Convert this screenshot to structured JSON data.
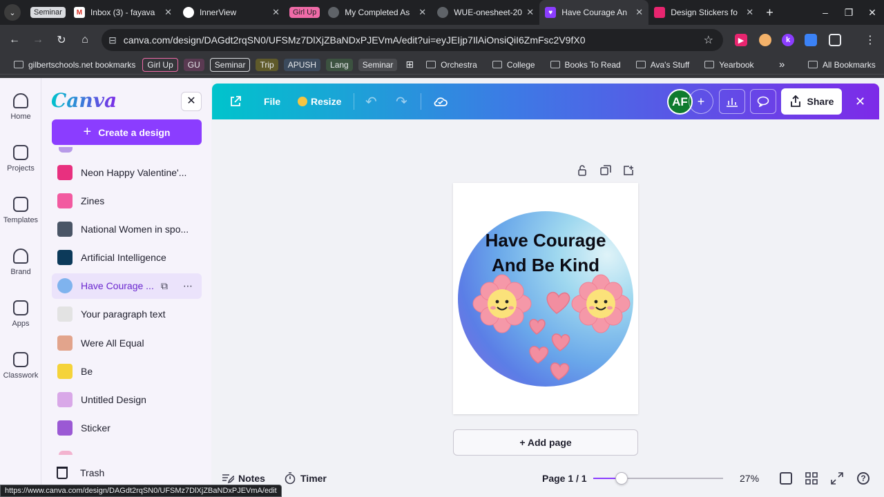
{
  "browser": {
    "tabs": [
      {
        "label": "Seminar",
        "kind": "group",
        "color": "#dadce0",
        "text": "#202124"
      },
      {
        "label": "Inbox (3) - fayava",
        "icon": "gmail-icon",
        "fav_color": "#ffffff",
        "fav_text": "M"
      },
      {
        "label": "InnerView",
        "icon": "innerview-icon",
        "fav_color": "#ffffff",
        "fav_text": ""
      },
      {
        "label": "Girl Up",
        "kind": "group",
        "color": "#f06ba8",
        "text": "#202124"
      },
      {
        "label": "My Completed As",
        "icon": "globe-icon",
        "fav_color": "#5f6368",
        "fav_text": ""
      },
      {
        "label": "WUE-onesheet-20",
        "icon": "globe-icon",
        "fav_color": "#5f6368",
        "fav_text": ""
      },
      {
        "label": "Have Courage An",
        "icon": "canva-heart-icon",
        "fav_color": "#8b3dff",
        "fav_text": "♥",
        "active": true
      },
      {
        "label": "Design Stickers fo",
        "icon": "contact-icon",
        "fav_color": "#e8256f",
        "fav_text": ""
      }
    ],
    "new_tab": "+",
    "window_controls": [
      "–",
      "❐",
      "✕"
    ],
    "url": "canva.com/design/DAGdt2rqSN0/UFSMz7DlXjZBaNDxPJEVmA/edit?ui=eyJEIjp7IlAiOnsiQiI6ZmFsc2V9fX0",
    "bookmarks": {
      "first": "gilbertschools.net bookmarks",
      "chips": [
        {
          "label": "Girl Up",
          "bg": "#f06ba8",
          "fg": "#202124",
          "outline": true
        },
        {
          "label": "GU",
          "bg": "#5a3a52",
          "fg": "#e8eaed"
        },
        {
          "label": "Seminar",
          "bg": "#dadce0",
          "fg": "#202124",
          "outline": true
        },
        {
          "label": "Trip",
          "bg": "#5f5a2a",
          "fg": "#e8eaed"
        },
        {
          "label": "APUSH",
          "bg": "#3b4a5c",
          "fg": "#e8eaed"
        },
        {
          "label": "Lang",
          "bg": "#3c5240",
          "fg": "#e8eaed"
        },
        {
          "label": "Seminar",
          "bg": "#4a4b4f",
          "fg": "#e8eaed"
        }
      ],
      "folders": [
        "Orchestra",
        "College",
        "Books To Read",
        "Ava's Stuff",
        "Yearbook"
      ],
      "more": "»",
      "all": "All Bookmarks"
    },
    "status_url": "https://www.canva.com/design/DAGdt2rqSN0/UFSMz7DlXjZBaNDxPJEVmA/edit"
  },
  "rail": [
    {
      "label": "Home",
      "icon": "home-icon"
    },
    {
      "label": "Projects",
      "icon": "folder-icon"
    },
    {
      "label": "Templates",
      "icon": "templates-icon"
    },
    {
      "label": "Brand",
      "icon": "brand-icon"
    },
    {
      "label": "Apps",
      "icon": "apps-icon"
    },
    {
      "label": "Classwork",
      "icon": "classwork-icon"
    }
  ],
  "panel": {
    "logo": "Canva",
    "close": "✕",
    "create": "Create a design",
    "designs": [
      {
        "label": "Neon Happy Valentine'...",
        "thumb": "#e8307f"
      },
      {
        "label": "Zines",
        "thumb": "#f25aa0"
      },
      {
        "label": "National Women in spo...",
        "thumb": "#4a5566"
      },
      {
        "label": "Artificial Intelligence",
        "thumb": "#0c3a5a"
      },
      {
        "label": "Have Courage ...",
        "thumb": "#7fb3ee",
        "active": true
      },
      {
        "label": "Your paragraph text",
        "thumb": "#e3e3e3"
      },
      {
        "label": "Were All Equal",
        "thumb": "#e2a48c"
      },
      {
        "label": "Be",
        "thumb": "#f5d33a"
      },
      {
        "label": "Untitled Design",
        "thumb": "#d9a8e8"
      },
      {
        "label": "Sticker",
        "thumb": "#9b59d4"
      }
    ],
    "trash": "Trash"
  },
  "header": {
    "file": "File",
    "resize": "Resize",
    "avatar": "AF",
    "share": "Share",
    "close": "✕"
  },
  "canvas": {
    "sticker_line1": "Have Courage",
    "sticker_line2": "And Be Kind",
    "add_page": "+  Add page"
  },
  "footer": {
    "notes": "Notes",
    "timer": "Timer",
    "page": "Page 1 / 1",
    "zoom": "27%",
    "zoom_fraction": 0.27
  }
}
